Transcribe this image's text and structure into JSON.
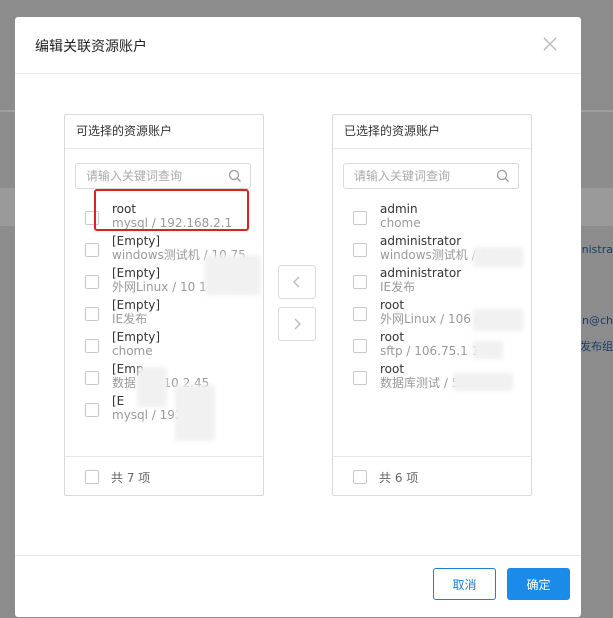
{
  "background": {
    "right_texts": [
      "nistra",
      "n@ch",
      "发布组"
    ]
  },
  "modal": {
    "title": "编辑关联资源账户",
    "left_panel": {
      "title": "可选择的资源账户",
      "search_placeholder": "请输入关键词查询",
      "items": [
        {
          "name": "root",
          "sub": "mysql / 192.168.2.1"
        },
        {
          "name": "[Empty]",
          "sub": "windows测试机 / 10.75..."
        },
        {
          "name": "[Empty]",
          "sub": "外网Linux / 10    147."
        },
        {
          "name": "[Empty]",
          "sub": "IE发布"
        },
        {
          "name": "[Empty]",
          "sub": "chome"
        },
        {
          "name": "[Emp",
          "sub": "数据   试 / 10      2.45"
        },
        {
          "name": "[E",
          "sub": "mysql / 192    2.1"
        }
      ],
      "footer": "共 7 项"
    },
    "right_panel": {
      "title": "已选择的资源账户",
      "search_placeholder": "请输入关键词查询",
      "items": [
        {
          "name": "admin",
          "sub": "chome"
        },
        {
          "name": "administrator",
          "sub": "windows测试机 /    75...."
        },
        {
          "name": "administrator",
          "sub": "IE发布"
        },
        {
          "name": "root",
          "sub": "外网Linux / 106    47."
        },
        {
          "name": "root",
          "sub": "sftp / 106.75.1     16"
        },
        {
          "name": "root",
          "sub": "数据库测试 /        5"
        }
      ],
      "footer": "共 6 项"
    },
    "buttons": {
      "cancel": "取消",
      "ok": "确定"
    }
  },
  "colors": {
    "primary": "#1a8be8",
    "highlight": "#e0211f"
  }
}
